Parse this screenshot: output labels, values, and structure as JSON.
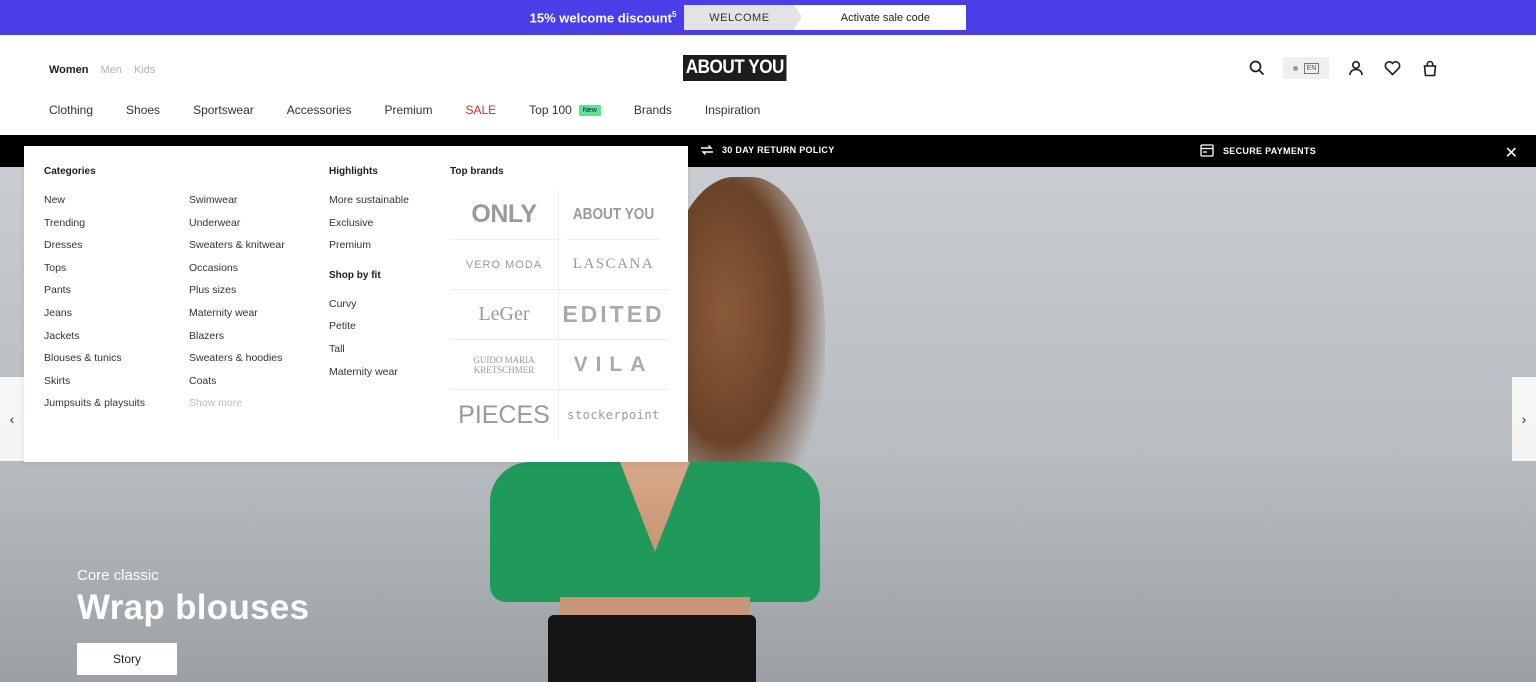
{
  "promo": {
    "text": "15% welcome discount",
    "sup": "5",
    "code": "WELCOME",
    "activate": "Activate sale code"
  },
  "header": {
    "gender_tabs": [
      "Women",
      "Men",
      "Kids"
    ],
    "logo": "ABOUT YOU",
    "lang": "EN",
    "nav": [
      "Clothing",
      "Shoes",
      "Sportswear",
      "Accessories",
      "Premium",
      "SALE",
      "Top 100",
      "Brands",
      "Inspiration"
    ],
    "nav_badge": "New"
  },
  "infobar": {
    "return": "30 DAY RETURN POLICY",
    "payments": "SECURE PAYMENTS"
  },
  "menu": {
    "categories_title": "Categories",
    "categories_col1": [
      "New",
      "Trending",
      "Dresses",
      "Tops",
      "Pants",
      "Jeans",
      "Jackets",
      "Blouses & tunics",
      "Skirts",
      "Jumpsuits & playsuits"
    ],
    "categories_col2": [
      "Swimwear",
      "Underwear",
      "Sweaters & knitwear",
      "Occasions",
      "Plus sizes",
      "Maternity wear",
      "Blazers",
      "Sweaters & hoodies",
      "Coats"
    ],
    "show_more": "Show more",
    "highlights_title": "Highlights",
    "highlights": [
      "More sustainable",
      "Exclusive",
      "Premium"
    ],
    "fit_title": "Shop by fit",
    "fit": [
      "Curvy",
      "Petite",
      "Tall",
      "Maternity wear"
    ],
    "brands_title": "Top brands",
    "brands": [
      "ONLY",
      "ABOUT YOU",
      "VERO MODA",
      "LASCANA",
      "LeGer",
      "EDITED",
      "GUIDO MARIA KRETSCHMER",
      "VILA",
      "PIECES",
      "stockerpoint"
    ]
  },
  "hero": {
    "subtitle": "Core classic",
    "title": "Wrap blouses",
    "button": "Story"
  },
  "colors": {
    "promo": "#4a3ee8",
    "sale": "#d92b2b",
    "badge": "#5ee38f",
    "shirt": "#1f9a5b"
  }
}
